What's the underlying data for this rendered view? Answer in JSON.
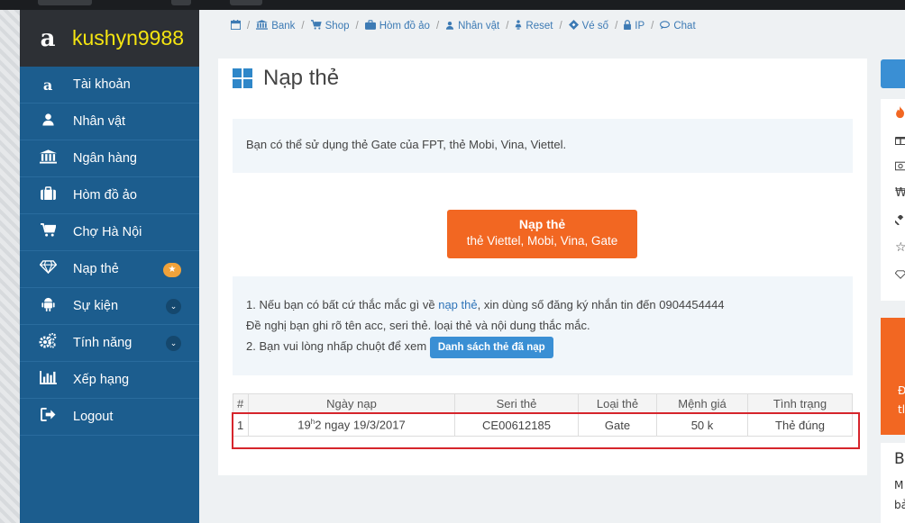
{
  "brand": {
    "name": "kushyn9988"
  },
  "sidebar": {
    "items": [
      {
        "label": "Tài khoản",
        "icon": "amazon-icon"
      },
      {
        "label": "Nhân vật",
        "icon": "user-icon"
      },
      {
        "label": "Ngân hàng",
        "icon": "bank-icon"
      },
      {
        "label": "Hòm đồ ảo",
        "icon": "briefcase-icon"
      },
      {
        "label": "Chợ Hà Nội",
        "icon": "cart-icon"
      },
      {
        "label": "Nạp thẻ",
        "icon": "diamond-icon",
        "badge": "★"
      },
      {
        "label": "Sự kiện",
        "icon": "android-icon",
        "chevron": "⌄"
      },
      {
        "label": "Tính năng",
        "icon": "cogs-icon",
        "chevron": "⌄"
      },
      {
        "label": "Xếp hạng",
        "icon": "bar-chart-icon"
      },
      {
        "label": "Logout",
        "icon": "sign-out-icon"
      }
    ]
  },
  "breadcrumb": [
    {
      "label": "",
      "icon": "calendar-icon"
    },
    {
      "label": "Bank",
      "icon": "bank-icon"
    },
    {
      "label": "Shop",
      "icon": "cart-icon"
    },
    {
      "label": "Hòm đồ ảo",
      "icon": "briefcase-icon"
    },
    {
      "label": "Nhân vật",
      "icon": "user-icon"
    },
    {
      "label": "Reset",
      "icon": "female-icon"
    },
    {
      "label": "Vé số",
      "icon": "ticket-icon"
    },
    {
      "label": "IP",
      "icon": "lock-icon"
    },
    {
      "label": "Chat",
      "icon": "comment-icon"
    }
  ],
  "main": {
    "title": "Nạp thẻ",
    "info": "Bạn có thể sử dụng thẻ Gate của FPT, thẻ Mobi, Vina, Viettel.",
    "button": {
      "line1": "Nạp thẻ",
      "line2": "thẻ Viettel, Mobi, Vina, Gate"
    },
    "note": {
      "line1_prefix": "1. Nếu bạn có bất cứ thắc mắc gì về ",
      "line1_link": "nạp thẻ",
      "line1_suffix": ", xin dùng số đăng ký nhắn tin đến 0904454444",
      "line2": "Đề nghị bạn ghi rõ tên acc, seri thẻ. loại thẻ và nội dung thắc mắc.",
      "line3_prefix": "2. Bạn vui lòng nhấp chuột để xem",
      "list_button": "Danh sách thẻ đã nạp"
    },
    "table": {
      "headers": [
        "#",
        "Ngày nạp",
        "Seri thẻ",
        "Loại thẻ",
        "Mệnh giá",
        "Tình trạng"
      ],
      "rows": [
        {
          "idx": "1",
          "date_hour": "19",
          "date_h": "h",
          "date_rest": "2 ngay 19/3/2017",
          "serial": "CE00612185",
          "type": "Gate",
          "value": "50 k",
          "status": "Thẻ đúng"
        }
      ]
    }
  },
  "right": {
    "orange_lines": [
      "Đ",
      "tl"
    ],
    "white_title": "B",
    "white_lines": [
      "M",
      "bả"
    ]
  }
}
